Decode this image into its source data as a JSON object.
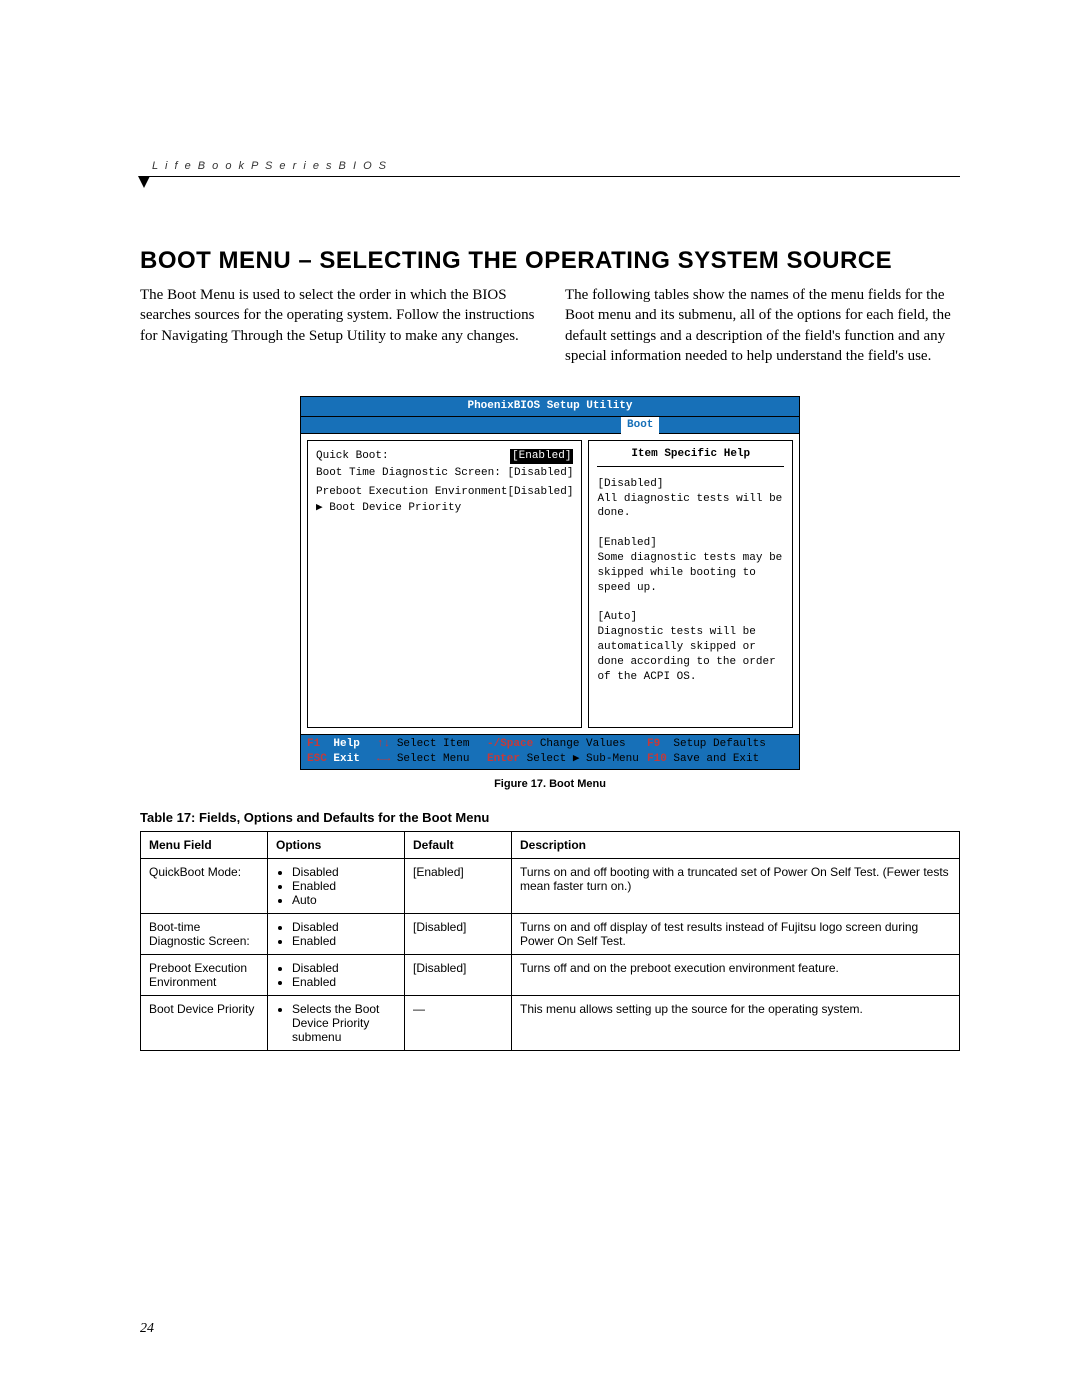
{
  "running_head": "L i f e B o o k   P   S e r i e s   B I O S",
  "section_title": "BOOT MENU – SELECTING THE OPERATING SYSTEM SOURCE",
  "intro_para_1": "The Boot Menu is used to select the order in which the BIOS searches sources for the operating system. Follow the instructions for Navigating Through the Setup Utility to make any changes.",
  "intro_para_2": "The following tables show the names of the menu fields for the Boot menu and its submenu, all of the options for each field, the default settings and a description of the field's function and any special information needed to help understand the field's use.",
  "bios": {
    "title": "PhoenixBIOS Setup Utility",
    "active_tab": "Boot",
    "settings": [
      {
        "label": "Quick Boot:",
        "value": "[Enabled]",
        "highlight": true
      },
      {
        "label": "Boot Time Diagnostic Screen:",
        "value": "[Disabled]"
      },
      {
        "label": "",
        "value": ""
      },
      {
        "label": "Preboot Execution Environment",
        "value": "[Disabled]"
      },
      {
        "label": "▶ Boot Device Priority",
        "value": ""
      }
    ],
    "help_title": "Item Specific Help",
    "help_body": "[Disabled]\nAll diagnostic tests will be done.\n\n[Enabled]\nSome diagnostic tests may be skipped while booting to speed up.\n\n[Auto]\nDiagnostic tests will be automatically skipped or done according to the order of the ACPI OS.",
    "footer": {
      "row1": {
        "c1k": "F1",
        "c1t": "Help",
        "c2k": "↑↓",
        "c2t": "Select Item",
        "c3k": "-/Space",
        "c3t": "Change Values",
        "c4k": "F9",
        "c4t": "Setup Defaults"
      },
      "row2": {
        "c1k": "ESC",
        "c1t": "Exit",
        "c2k": "←→",
        "c2t": "Select Menu",
        "c3k": "Enter",
        "c3t": "Select ▶ Sub-Menu",
        "c4k": "F10",
        "c4t": "Save and Exit"
      }
    }
  },
  "figure_caption": "Figure 17.  Boot Menu",
  "table_caption": "Table 17: Fields, Options and Defaults for the Boot Menu",
  "table": {
    "headers": [
      "Menu Field",
      "Options",
      "Default",
      "Description"
    ],
    "rows": [
      {
        "field": "QuickBoot Mode:",
        "options": [
          "Disabled",
          "Enabled",
          "Auto"
        ],
        "default": "[Enabled]",
        "description": "Turns on and off booting with a truncated set of Power On Self Test. (Fewer tests mean faster turn on.)"
      },
      {
        "field": "Boot-time Diagnostic Screen:",
        "options": [
          "Disabled",
          "Enabled"
        ],
        "default": "[Disabled]",
        "description": "Turns on and off display of test results instead of Fujitsu logo screen during Power On Self Test."
      },
      {
        "field": "Preboot Execution Environment",
        "options": [
          "Disabled",
          "Enabled"
        ],
        "default": "[Disabled]",
        "description": "Turns off and on the preboot execution environment feature."
      },
      {
        "field": "Boot Device Priority",
        "options": [
          "Selects the Boot Device Priority submenu"
        ],
        "default": "—",
        "description": "This menu allows setting up the source for the operating system."
      }
    ]
  },
  "page_number": "24"
}
